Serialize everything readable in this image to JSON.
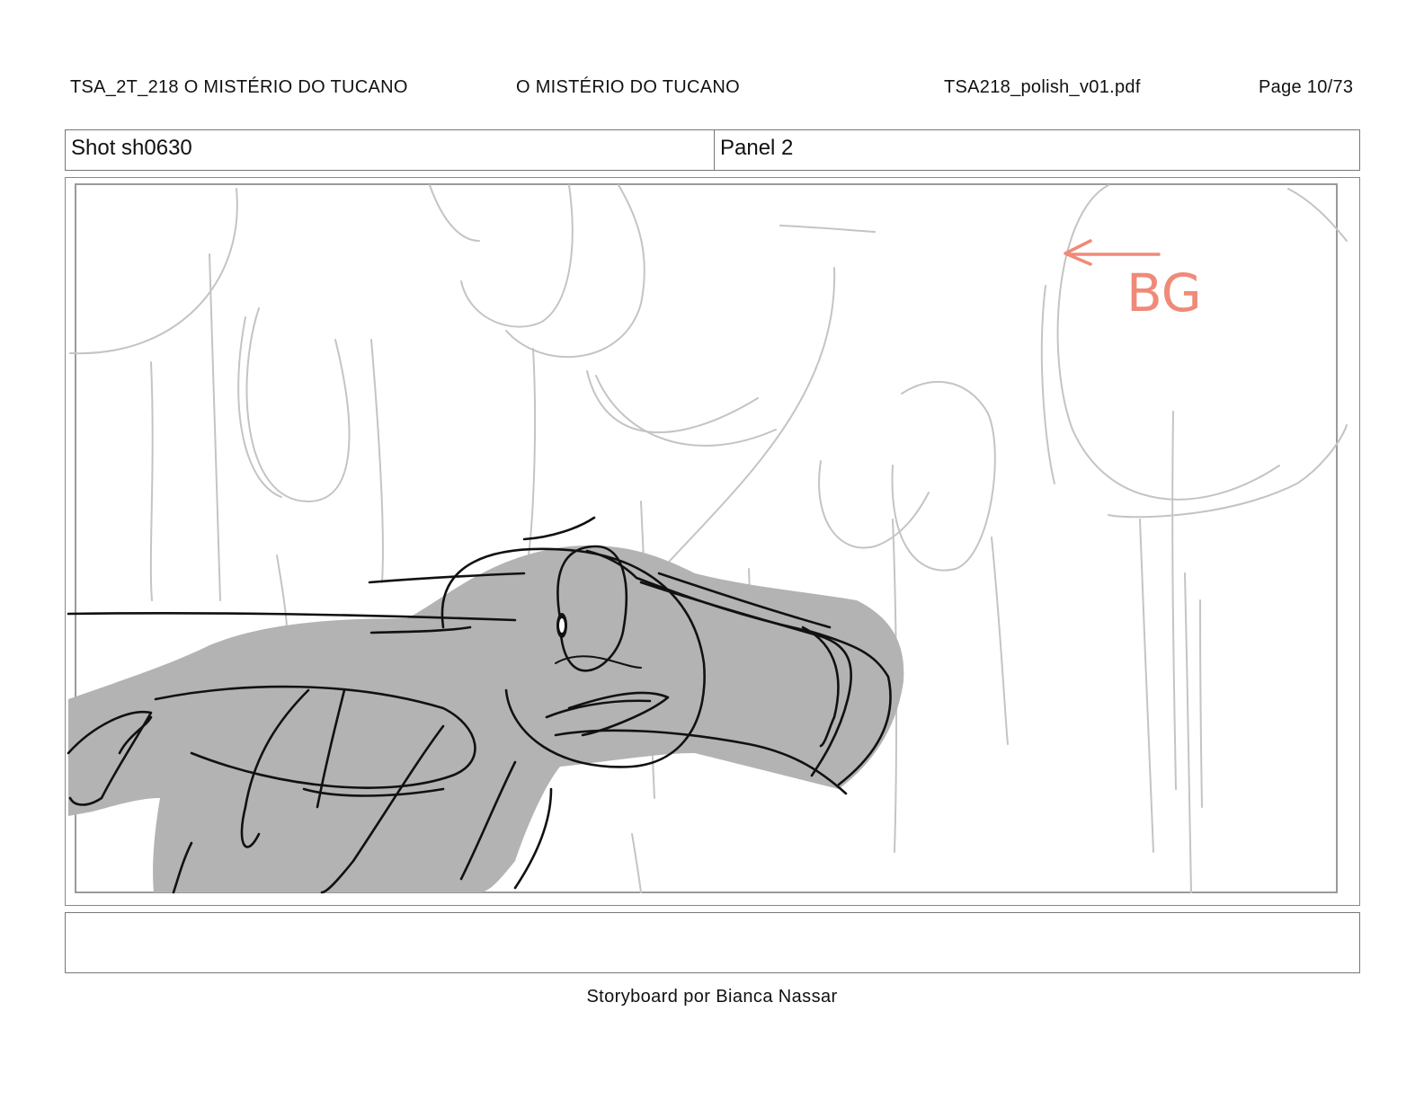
{
  "header": {
    "episode_title": "TSA_2T_218  O MISTÉRIO DO TUCANO",
    "center_title": "O MISTÉRIO DO TUCANO",
    "file_name": "TSA218_polish_v01.pdf",
    "page_label": "Page 10/73"
  },
  "shot": {
    "shot_label": "Shot sh0630",
    "panel_label": "Panel 2"
  },
  "panel": {
    "annotation_text": "BG",
    "annotation_color": "#f08a78",
    "sketch_fill_color": "#b3b3b3",
    "background_line_color": "#c4c4c4",
    "character_line_color": "#111111"
  },
  "caption": {
    "text": ""
  },
  "footer": {
    "credit": "Storyboard por Bianca Nassar"
  }
}
